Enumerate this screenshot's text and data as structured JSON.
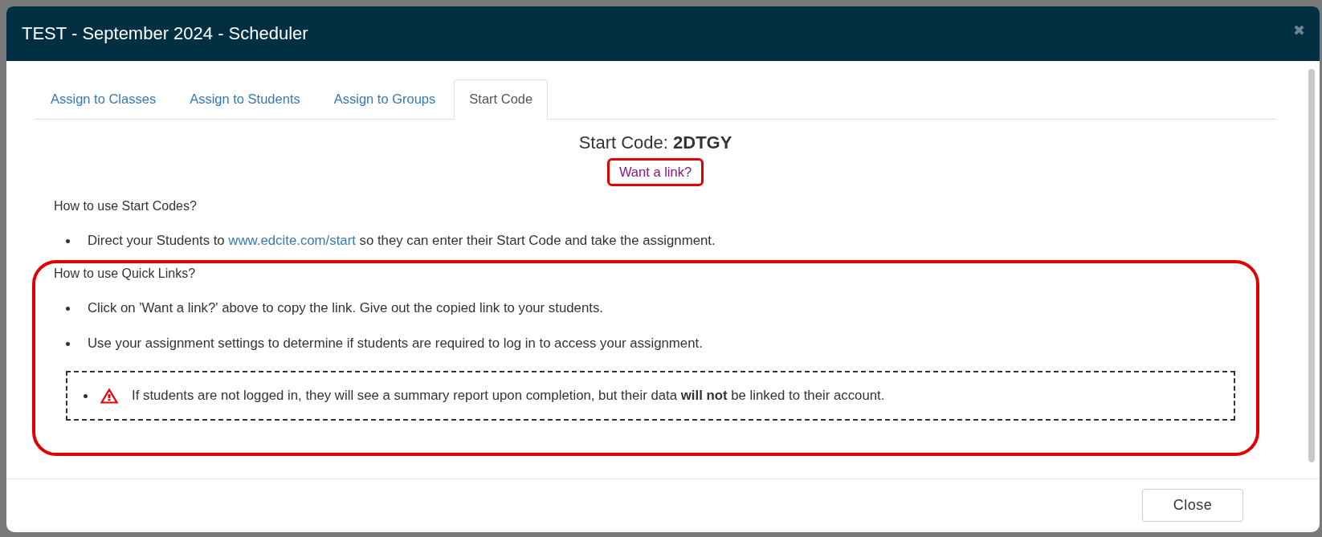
{
  "window": {
    "title": "TEST - September 2024 - Scheduler",
    "close_glyph": "✖"
  },
  "tabs": [
    {
      "label": "Assign to Classes",
      "selected": false
    },
    {
      "label": "Assign to Students",
      "selected": false
    },
    {
      "label": "Assign to Groups",
      "selected": false
    },
    {
      "label": "Start Code",
      "selected": true
    }
  ],
  "start_code": {
    "label": "Start Code:",
    "code": "2DTGY",
    "link": "Want a link?",
    "link_highlighted": true
  },
  "sections": [
    {
      "heading": "How to use Start Codes?",
      "highlighted": false,
      "items": [
        {
          "kind": "link",
          "before": "Direct your Students to ",
          "link": "www.edcite.com/start",
          "after": " so they can enter their Start Code and take the assignment."
        }
      ]
    },
    {
      "heading": "How to use Quick Links?",
      "highlighted": true,
      "items": [
        {
          "kind": "plain",
          "text": "Click on 'Want a link?' above to copy the link. Give out the copied link to your students."
        },
        {
          "kind": "plain",
          "text": "Use your assignment settings to determine if students are required to log in to access your assignment."
        },
        {
          "kind": "warning",
          "text": "If students are not logged in, they will see a summary report upon completion, but their data **will not** be linked to their account."
        }
      ]
    }
  ],
  "footer": {
    "button": "Close"
  }
}
